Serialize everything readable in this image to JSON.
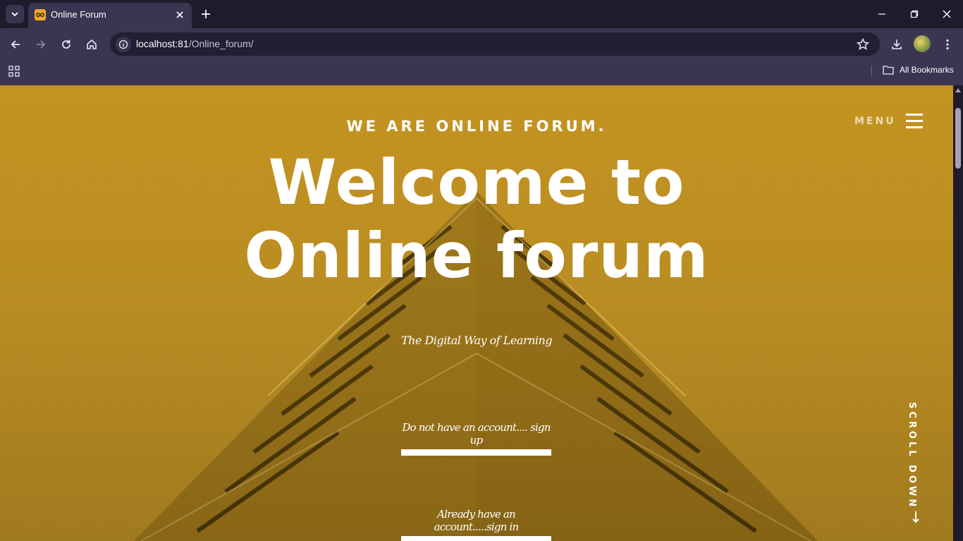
{
  "browser": {
    "tab": {
      "title": "Online Forum",
      "favicon": "infinity-icon"
    },
    "url": {
      "host": "localhost:81",
      "path": "/Online_forum/"
    },
    "bookmarks": {
      "all_label": "All Bookmarks"
    }
  },
  "page": {
    "tagline": "WE ARE ONLINE FORUM.",
    "title": "Welcome to Online forum",
    "subtitle": "The Digital Way of Learning",
    "menu_label": "MENU",
    "cta_signup": "Do not have an account.... sign up",
    "cta_signin": "Already have an account.....sign in",
    "scroll_down": "SCROLL DOWN",
    "colors": {
      "hero_bg": "#c49421",
      "text": "#ffffff",
      "menu_label": "#e9dcb0"
    }
  }
}
